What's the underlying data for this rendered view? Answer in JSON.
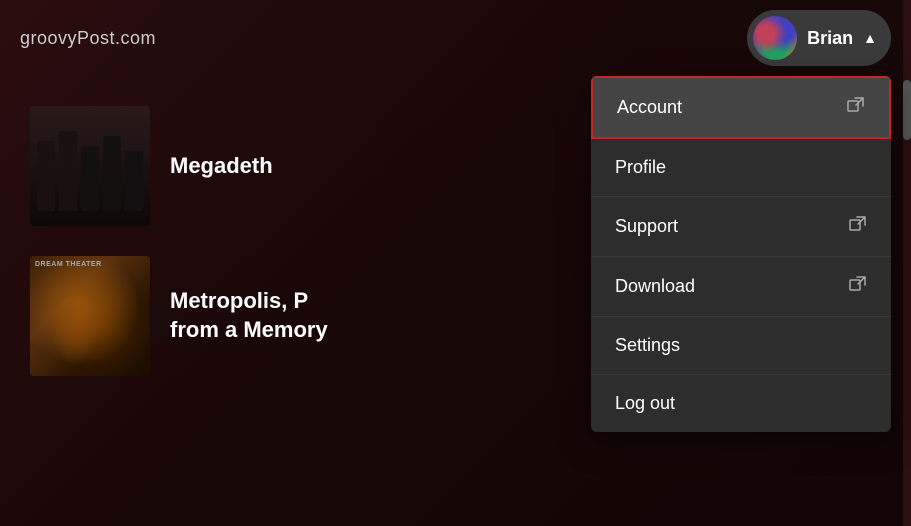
{
  "header": {
    "logo_text": "groovyPost.com",
    "user_name": "Brian",
    "chevron": "▲"
  },
  "menu": {
    "items": [
      {
        "id": "account",
        "label": "Account",
        "has_external": true,
        "highlighted": true
      },
      {
        "id": "profile",
        "label": "Profile",
        "has_external": false,
        "highlighted": false
      },
      {
        "id": "support",
        "label": "Support",
        "has_external": true,
        "highlighted": false
      },
      {
        "id": "download",
        "label": "Download",
        "has_external": true,
        "highlighted": false
      },
      {
        "id": "settings",
        "label": "Settings",
        "has_external": false,
        "highlighted": false
      },
      {
        "id": "logout",
        "label": "Log out",
        "has_external": false,
        "highlighted": false
      }
    ],
    "external_icon": "⧉"
  },
  "content": {
    "albums": [
      {
        "id": "megadeth",
        "title": "Megadeth"
      },
      {
        "id": "dreamtheater",
        "title": "Metropolis, P\nfrom a Memory"
      }
    ]
  }
}
